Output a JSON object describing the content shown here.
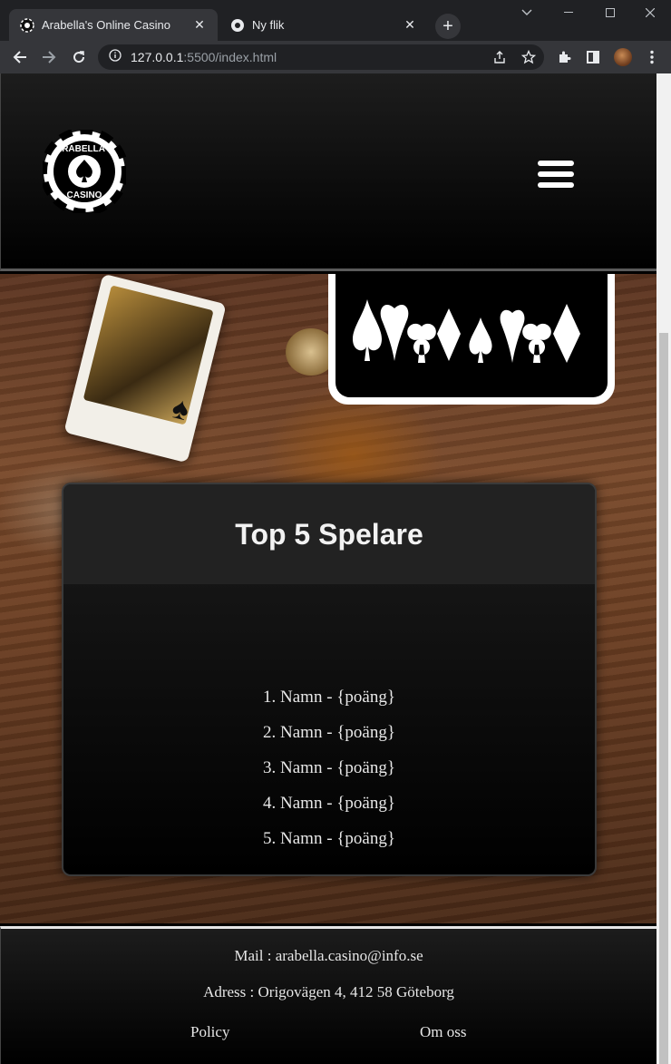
{
  "browser": {
    "tabs": [
      {
        "title": "Arabella's Online Casino",
        "icon": "casino-chip-icon",
        "active": true
      },
      {
        "title": "Ny flik",
        "icon": "chrome-icon",
        "active": false
      }
    ],
    "url_host": "127.0.0.1",
    "url_rest": ":5500/index.html"
  },
  "site": {
    "logo_alt": "Arabella's Casino",
    "logo_text_top": "ARABELLA'S",
    "logo_text_bottom": "CASINO"
  },
  "top5": {
    "title": "Top 5 Spelare",
    "players": [
      "1. Namn - {poäng}",
      "2. Namn - {poäng}",
      "3. Namn - {poäng}",
      "4. Namn - {poäng}",
      "5. Namn - {poäng}"
    ]
  },
  "footer": {
    "mail": "Mail : arabella.casino@info.se",
    "address": "Adress : Origovägen 4, 412 58 Göteborg",
    "policy": "Policy",
    "about": "Om oss"
  }
}
